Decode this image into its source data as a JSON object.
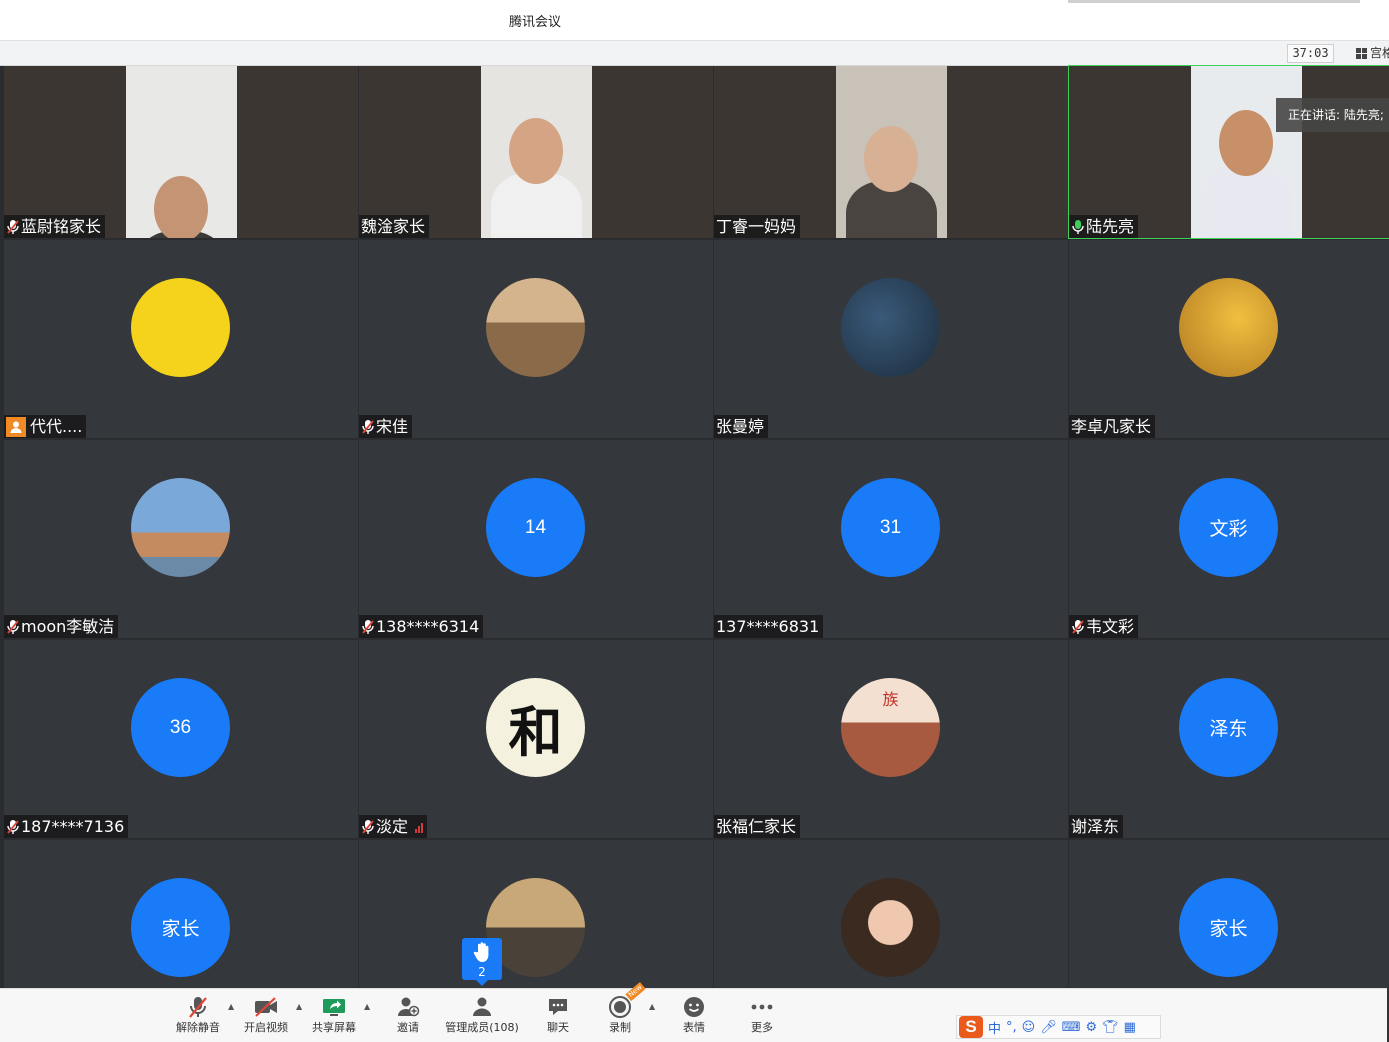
{
  "window": {
    "title": "腾讯会议"
  },
  "infobar": {
    "timer": "37:03",
    "view_label": "宫格"
  },
  "speaking": {
    "label": "正在讲话: 陆先亮;"
  },
  "participants": [
    {
      "name": "蓝尉铭家长",
      "mic": "muted",
      "kind": "video"
    },
    {
      "name": "魏淦家长",
      "mic": "none",
      "kind": "video"
    },
    {
      "name": "丁睿一妈妈",
      "mic": "none",
      "kind": "video"
    },
    {
      "name": "陆先亮",
      "mic": "on",
      "kind": "video"
    },
    {
      "name": "代代....",
      "mic": "none",
      "kind": "avatar",
      "badge": "person"
    },
    {
      "name": "宋佳",
      "mic": "muted",
      "kind": "avatar"
    },
    {
      "name": "张曼婷",
      "mic": "none",
      "kind": "avatar"
    },
    {
      "name": "李卓凡家长",
      "mic": "none",
      "kind": "avatar"
    },
    {
      "name": "moon李敏洁",
      "mic": "muted",
      "kind": "avatar"
    },
    {
      "name": "138****6314",
      "mic": "muted",
      "kind": "initials",
      "initials": "14"
    },
    {
      "name": "137****6831",
      "mic": "none",
      "kind": "initials",
      "initials": "31"
    },
    {
      "name": "韦文彩",
      "mic": "muted",
      "kind": "initials",
      "initials": "文彩"
    },
    {
      "name": "187****7136",
      "mic": "muted",
      "kind": "initials",
      "initials": "36"
    },
    {
      "name": "淡定",
      "mic": "muted",
      "kind": "avatar",
      "signal": "weak"
    },
    {
      "name": "张福仁家长",
      "mic": "none",
      "kind": "avatar"
    },
    {
      "name": "谢泽东",
      "mic": "none",
      "kind": "initials",
      "initials": "泽东"
    },
    {
      "name": "",
      "mic": "none",
      "kind": "initials",
      "initials": "家长"
    },
    {
      "name": "",
      "mic": "none",
      "kind": "avatar"
    },
    {
      "name": "",
      "mic": "none",
      "kind": "avatar"
    },
    {
      "name": "",
      "mic": "none",
      "kind": "initials",
      "initials": "家长"
    }
  ],
  "avatar_text": {
    "calligraphy": "和",
    "banner": "族"
  },
  "raise_hand": {
    "count": "2"
  },
  "toolbar": {
    "unmute": "解除静音",
    "start_video": "开启视频",
    "share_screen": "共享屏幕",
    "invite": "邀请",
    "manage_members": "管理成员(108)",
    "chat": "聊天",
    "record": "录制",
    "reactions": "表情",
    "more": "更多",
    "record_badge": "New"
  },
  "ime": {
    "logo": "S",
    "mode": "中",
    "punct": "°,"
  },
  "colors": {
    "accent": "#1a7bf8",
    "tile_bg": "#34373b",
    "muted_red": "#e0453a",
    "mic_green": "#3ccf5a"
  }
}
